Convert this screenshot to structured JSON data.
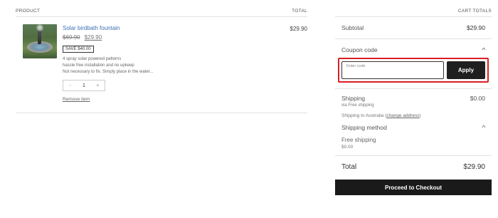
{
  "cart": {
    "header": {
      "product": "PRODUCT",
      "total": "TOTAL"
    },
    "item": {
      "name": "Solar birdbath fountain",
      "old_price": "$69.90",
      "price": "$29.90",
      "save_badge": "SAVE $40.00",
      "features": [
        "4 spray solar powered patterns",
        "hassle free installation and no upkeep",
        "Not necessary to fix. Simply place in the water..."
      ],
      "qty_minus": "-",
      "qty_value": "1",
      "qty_plus": "+",
      "remove": "Remove item",
      "line_total": "$29.90"
    }
  },
  "totals": {
    "header": "CART TOTALS",
    "subtotal_label": "Subtotal",
    "subtotal_value": "$29.90",
    "coupon_label": "Coupon code",
    "coupon_placeholder": "Enter code",
    "apply_label": "Apply",
    "shipping_label": "Shipping",
    "shipping_value": "$0.00",
    "shipping_via": "via Free shipping",
    "ship_to_prefix": "Shipping to Australia (",
    "change_address": "change address",
    "ship_to_suffix": ")",
    "method_label": "Shipping method",
    "method_name": "Free shipping",
    "method_price": "$0.00",
    "total_label": "Total",
    "total_value": "$29.90",
    "checkout_label": "Proceed to Checkout"
  },
  "colors": {
    "link": "#3d6fb6",
    "highlight": "#d91f26",
    "button_dark": "#1a1a1a"
  },
  "icons": {
    "coupon_toggle": "chevron-up-icon",
    "method_toggle": "chevron-up-icon"
  }
}
